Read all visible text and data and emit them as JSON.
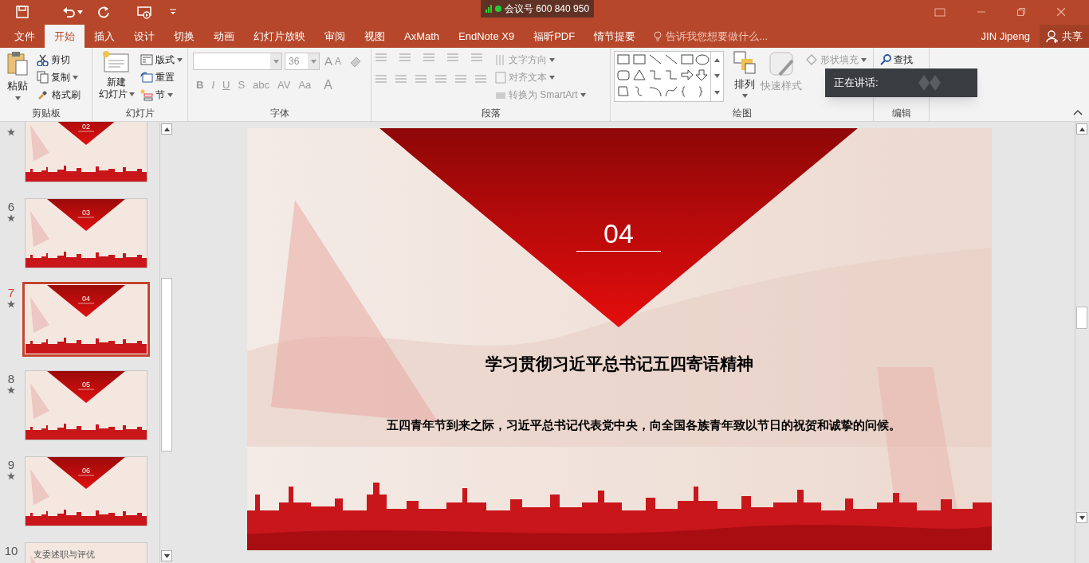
{
  "meeting_overlay": {
    "text": "会议号 600 840 950"
  },
  "tabs": [
    {
      "label": "文件",
      "selected": false
    },
    {
      "label": "开始",
      "selected": true
    },
    {
      "label": "插入",
      "selected": false
    },
    {
      "label": "设计",
      "selected": false
    },
    {
      "label": "切换",
      "selected": false
    },
    {
      "label": "动画",
      "selected": false
    },
    {
      "label": "幻灯片放映",
      "selected": false
    },
    {
      "label": "审阅",
      "selected": false
    },
    {
      "label": "视图",
      "selected": false
    },
    {
      "label": "AxMath",
      "selected": false
    },
    {
      "label": "EndNote X9",
      "selected": false
    },
    {
      "label": "福昕PDF",
      "selected": false
    },
    {
      "label": "情节提要",
      "selected": false
    }
  ],
  "tell_me": {
    "placeholder": "告诉我您想要做什么..."
  },
  "user": "JIN Jipeng",
  "share": "共享",
  "clipboard": {
    "label": "剪贴板",
    "paste": "粘贴",
    "cut": "剪切",
    "copy": "复制",
    "format_painter": "格式刷"
  },
  "slides_group": {
    "label": "幻灯片",
    "new_slide": [
      "新建",
      "幻灯片"
    ],
    "layout": "版式",
    "reset": "重置",
    "section": "节"
  },
  "font": {
    "label": "字体",
    "size": "36",
    "grow": "A",
    "shrink": "A",
    "buttons": [
      "B",
      "I",
      "U",
      "S",
      "abc",
      "AV",
      "Aa"
    ],
    "font_color_button": "A"
  },
  "paragraph": {
    "label": "段落",
    "text_direction": "文字方向",
    "align_text": "对齐文本",
    "smartart": "转换为 SmartArt"
  },
  "drawing": {
    "label": "绘图",
    "arrange": "排列",
    "quick_styles": "快速样式",
    "shape_fill": "形状填充"
  },
  "editing": {
    "label": "编辑",
    "find": "查找"
  },
  "speaking_popup": {
    "label": "正在讲话:"
  },
  "slides": [
    {
      "star": true,
      "section_number": "02",
      "selected": false
    },
    {
      "number": "6",
      "star": true,
      "section_number": "03",
      "selected": false
    },
    {
      "number": "7",
      "star": true,
      "section_number": "04",
      "selected": true
    },
    {
      "number": "8",
      "star": true,
      "section_number": "05",
      "selected": false
    },
    {
      "number": "9",
      "star": true,
      "section_number": "06",
      "selected": false
    },
    {
      "number": "10",
      "star": false,
      "title": "支委述职与评优",
      "selected": false
    }
  ],
  "slide": {
    "section_number": "04",
    "title": "学习贯彻习近平总书记五四寄语精神",
    "body": "五四青年节到来之际，习近平总书记代表党中央，向全国各族青年致以节日的祝贺和诚挚的问候。"
  }
}
